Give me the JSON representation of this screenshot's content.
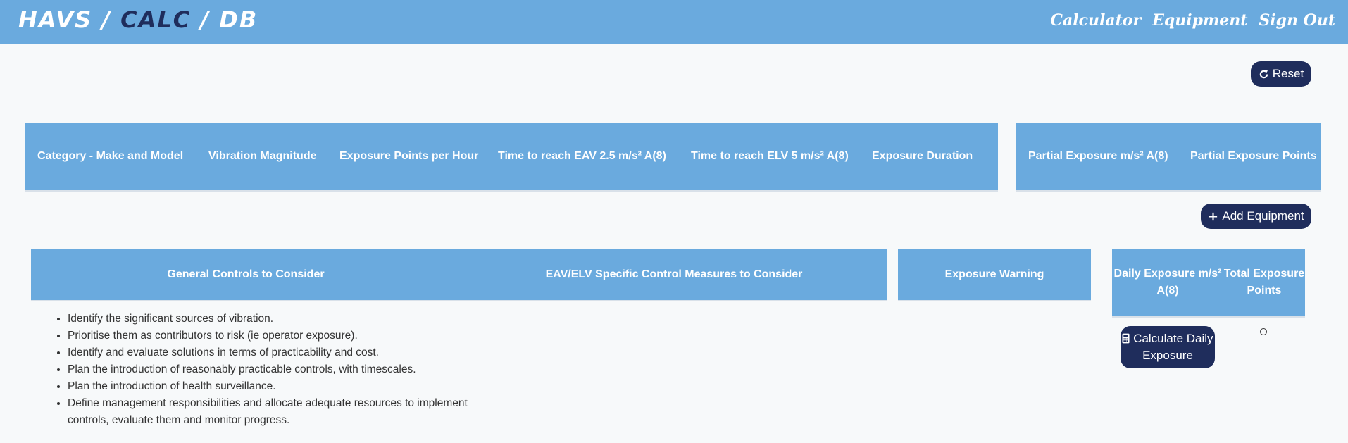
{
  "app": {
    "brand_left": "HAVS / ",
    "brand_mid": "CALC",
    "brand_right": " / DB",
    "nav": [
      "Calculator",
      "Equipment",
      "Sign Out"
    ]
  },
  "buttons": {
    "reset": "Reset",
    "add_equipment": "Add Equipment",
    "calculate_daily_exposure": "Calculate Daily Exposure"
  },
  "equipment_table": {
    "headers": [
      "Category - Make and Model",
      "Vibration Magnitude",
      "Exposure Points per Hour",
      "Time to reach EAV 2.5 m/s² A(8)",
      "Time to reach ELV 5 m/s² A(8)",
      "Exposure Duration"
    ]
  },
  "partial_table": {
    "headers": [
      "Partial Exposure m/s² A(8)",
      "Partial Exposure Points"
    ]
  },
  "controls_table": {
    "headers": [
      "General Controls to Consider",
      "EAV/ELV Specific Control Measures to Consider"
    ],
    "general_controls": [
      "Identify the significant sources of vibration.",
      "Prioritise them as contributors to risk (ie operator exposure).",
      "Identify and evaluate solutions in terms of practicability and cost.",
      "Plan the introduction of reasonably practicable controls, with timescales.",
      "Plan the introduction of health surveillance.",
      "Define management responsibilities and allocate adequate resources to implement controls, evaluate them and monitor progress."
    ]
  },
  "warning_table": {
    "header": "Exposure Warning"
  },
  "daily_table": {
    "headers": [
      "Daily Exposure m/s² A(8)",
      "Total Exposure Points"
    ],
    "total_points": "0"
  },
  "colors": {
    "header_bg": "#6aaade",
    "button_bg": "#1f2d5c",
    "page_bg": "#f7f9fa"
  },
  "icons": {
    "reset": "redo-icon",
    "add": "plus-icon",
    "calculate": "calculator-icon"
  }
}
